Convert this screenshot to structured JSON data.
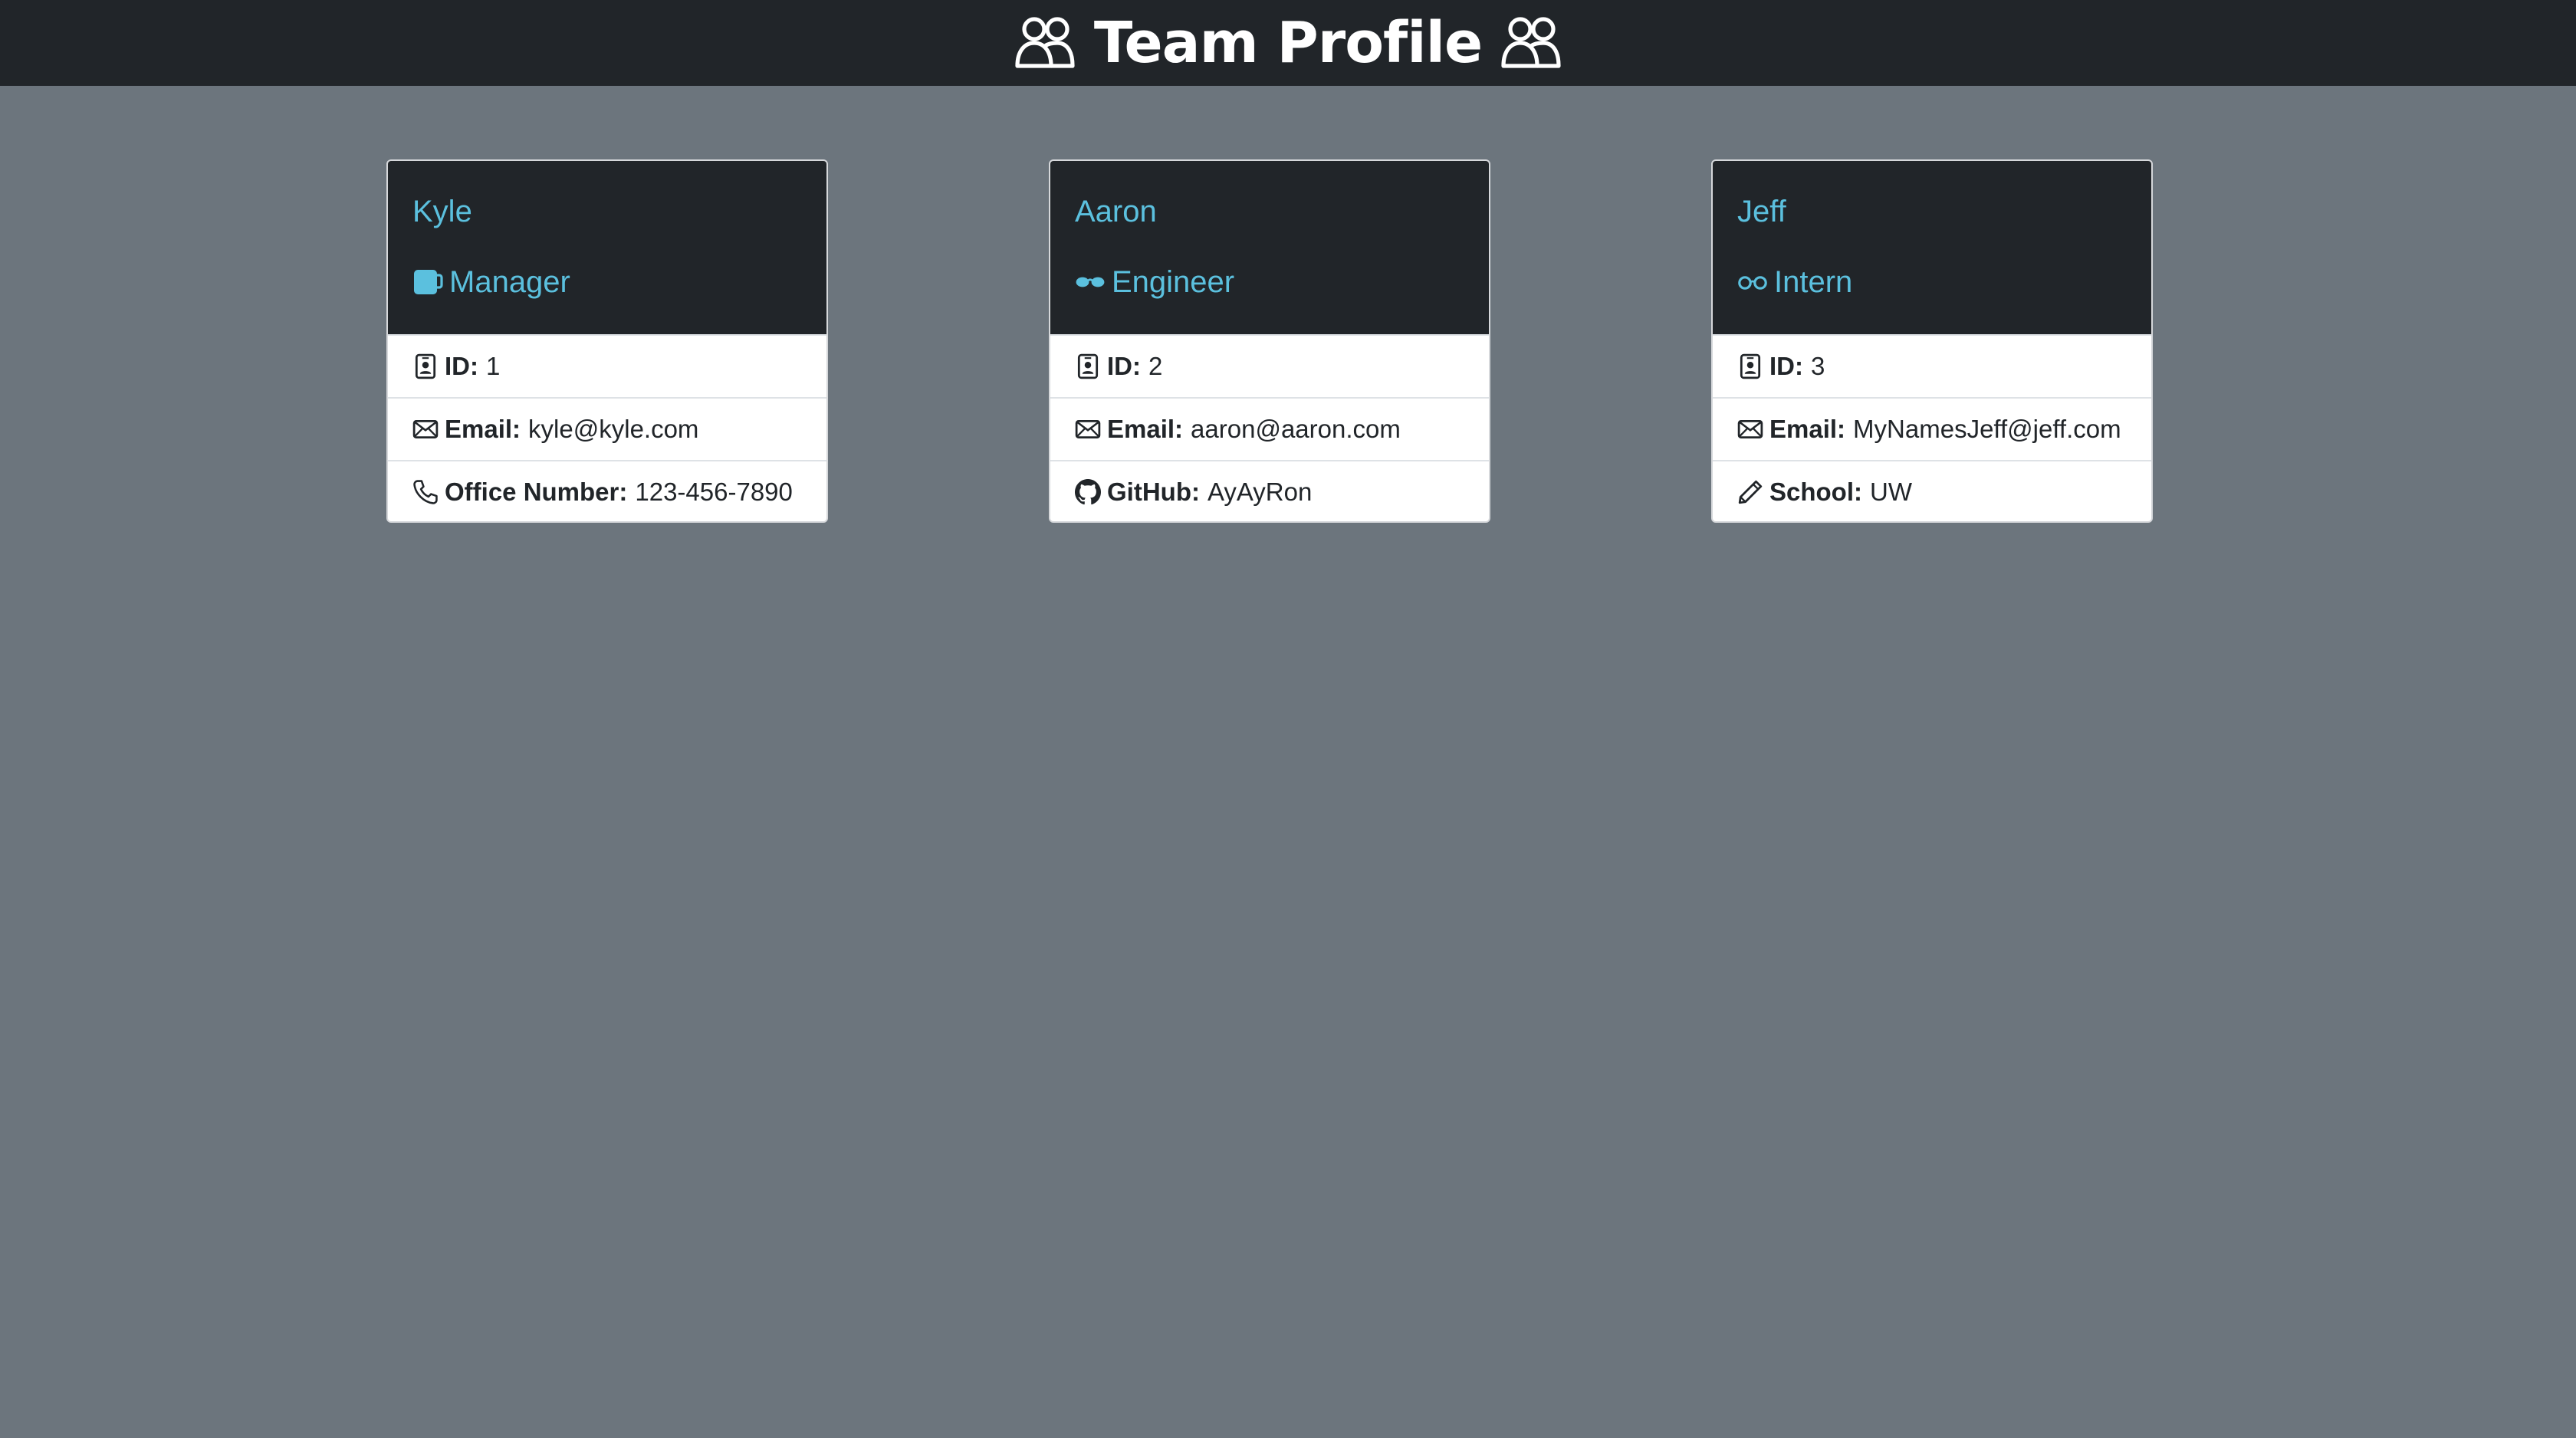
{
  "header": {
    "title": "Team Profile",
    "icon_left": "people-icon",
    "icon_right": "people-icon"
  },
  "colors": {
    "page_background": "#6c757d",
    "dark": "#212529",
    "accent": "#5bc0de",
    "card_body": "#ffffff"
  },
  "cards": [
    {
      "name": "Kyle",
      "role": "Manager",
      "role_icon": "cup-icon",
      "rows": [
        {
          "icon": "badge-icon",
          "label": "ID:",
          "value": "1"
        },
        {
          "icon": "envelope-icon",
          "label": "Email:",
          "value": "kyle@kyle.com"
        },
        {
          "icon": "telephone-icon",
          "label": "Office Number:",
          "value": "123-456-7890"
        }
      ]
    },
    {
      "name": "Aaron",
      "role": "Engineer",
      "role_icon": "sunglasses-icon",
      "rows": [
        {
          "icon": "badge-icon",
          "label": "ID:",
          "value": "2"
        },
        {
          "icon": "envelope-icon",
          "label": "Email:",
          "value": "aaron@aaron.com"
        },
        {
          "icon": "github-icon",
          "label": "GitHub:",
          "value": "AyAyRon"
        }
      ]
    },
    {
      "name": "Jeff",
      "role": "Intern",
      "role_icon": "eyeglasses-icon",
      "rows": [
        {
          "icon": "badge-icon",
          "label": "ID:",
          "value": "3"
        },
        {
          "icon": "envelope-icon",
          "label": "Email:",
          "value": "MyNamesJeff@jeff.com"
        },
        {
          "icon": "pencil-icon",
          "label": "School:",
          "value": "UW"
        }
      ]
    }
  ]
}
